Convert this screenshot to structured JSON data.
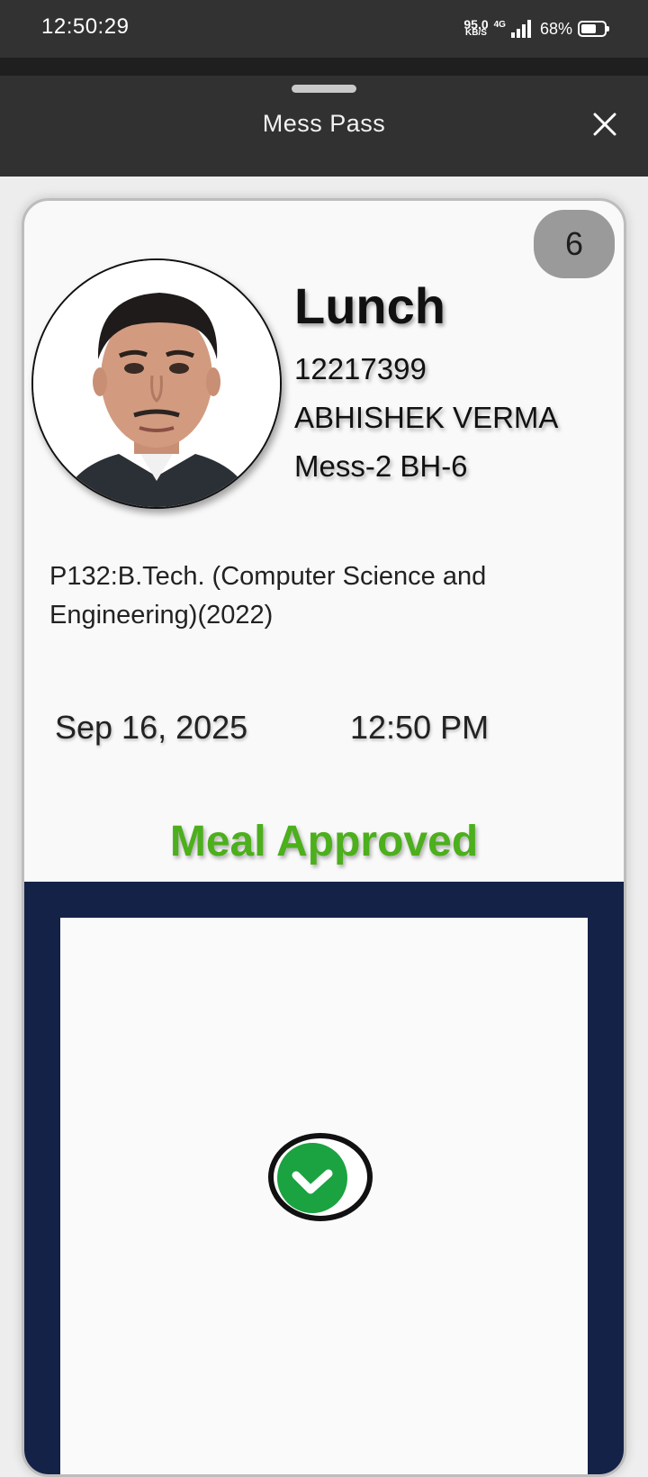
{
  "status_bar": {
    "time": "12:50:29",
    "net_speed_value": "95.0",
    "net_speed_unit": "KB/S",
    "network_type": "4G",
    "battery_percent": "68%",
    "battery_level": 0.68,
    "signal_bars": 4
  },
  "header": {
    "title": "Mess Pass",
    "close_icon": "close-icon"
  },
  "pass": {
    "count": "6",
    "meal": "Lunch",
    "roll_number": "12217399",
    "name": "ABHISHEK VERMA",
    "mess": "Mess-2 BH-6",
    "program": "P132:B.Tech. (Computer Science and Engineering)(2022)",
    "date": "Sep 16, 2025",
    "time": "12:50 PM",
    "status": "Meal Approved",
    "status_icon": "check-circle-icon"
  },
  "colors": {
    "approved_green": "#4caf1c",
    "panel_navy": "#152247",
    "check_green": "#1aa340",
    "header_bg": "#313131"
  }
}
